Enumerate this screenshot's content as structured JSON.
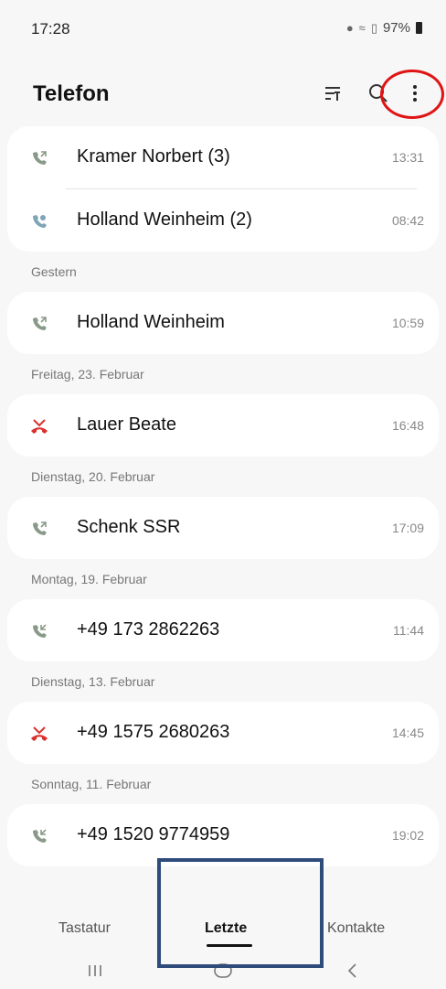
{
  "status_bar": {
    "time": "17:28",
    "battery": "97%"
  },
  "header": {
    "title": "Telefon"
  },
  "groups": [
    {
      "date": "",
      "calls": [
        {
          "name": "Kramer Norbert (3)",
          "time": "13:31",
          "type": "outgoing"
        },
        {
          "name": "Holland  Weinheim (2)",
          "time": "08:42",
          "type": "incoming"
        }
      ]
    },
    {
      "date": "Gestern",
      "calls": [
        {
          "name": "Holland  Weinheim",
          "time": "10:59",
          "type": "outgoing"
        }
      ]
    },
    {
      "date": "Freitag, 23. Februar",
      "calls": [
        {
          "name": "Lauer  Beate",
          "time": "16:48",
          "type": "missed"
        }
      ]
    },
    {
      "date": "Dienstag, 20. Februar",
      "calls": [
        {
          "name": "Schenk SSR",
          "time": "17:09",
          "type": "outgoing"
        }
      ]
    },
    {
      "date": "Montag, 19. Februar",
      "calls": [
        {
          "name": "+49 173 2862263",
          "time": "11:44",
          "type": "incoming"
        }
      ]
    },
    {
      "date": "Dienstag, 13. Februar",
      "calls": [
        {
          "name": "+49 1575 2680263",
          "time": "14:45",
          "type": "missed"
        }
      ]
    },
    {
      "date": "Sonntag, 11. Februar",
      "calls": [
        {
          "name": "+49 1520 9774959",
          "time": "19:02",
          "type": "incoming"
        }
      ]
    }
  ],
  "bottom_nav": {
    "tabs": [
      "Tastatur",
      "Letzte",
      "Kontakte"
    ],
    "active": "Letzte"
  },
  "colors": {
    "call_icon": "#8a9a8a",
    "missed": "#d9302e",
    "highlight_circle": "#e01414",
    "highlight_rect": "#2e4b7a"
  },
  "icons": {
    "filter": "filter-icon",
    "search": "search-icon",
    "more": "more-vertical-icon"
  }
}
